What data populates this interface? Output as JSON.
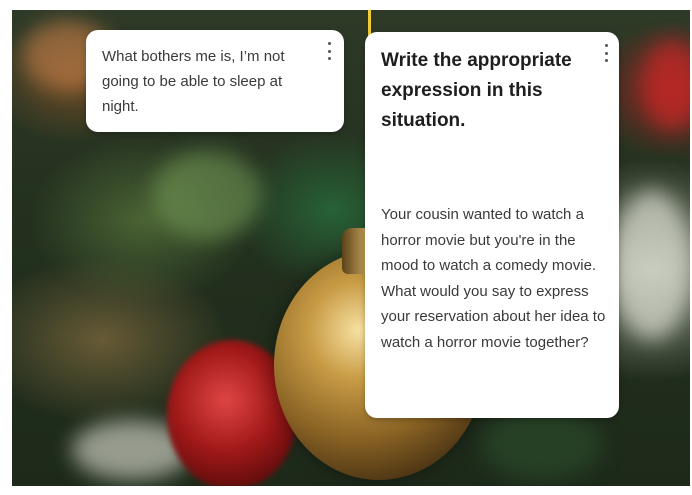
{
  "left_card": {
    "text": "What bothers me is, I’m not going to be able to sleep at night.",
    "menu_icon": "more-vertical-icon"
  },
  "right_card": {
    "title": "Write the appropriate expression in this situation.",
    "body": "Your cousin wanted to watch a horror movie but you're in the mood to watch a comedy movie. What would you say to express your reservation about her idea to watch a horror movie together?",
    "menu_icon": "more-vertical-icon"
  },
  "colors": {
    "card_background": "#ffffff",
    "title_text": "#1e1e1e",
    "body_text": "#3a3a3a"
  }
}
